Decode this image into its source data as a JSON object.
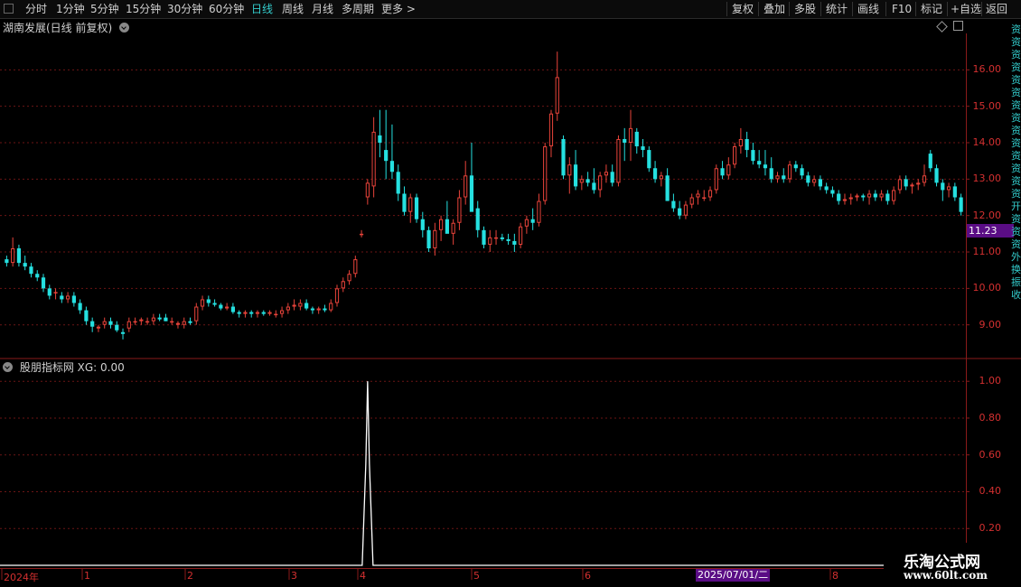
{
  "toolbar": {
    "left_items": [
      "分时",
      "1分钟",
      "5分钟",
      "15分钟",
      "30分钟",
      "60分钟",
      "日线",
      "周线",
      "月线",
      "多周期",
      "更多 >"
    ],
    "active": "日线",
    "right_items": [
      "复权",
      "叠加",
      "多股",
      "统计",
      "画线",
      "F10",
      "标记",
      "+自选",
      "返回"
    ]
  },
  "main_panel": {
    "title": "湖南发展(日线 前复权)",
    "current_price": "11.23"
  },
  "indicator_panel": {
    "title": "股朋指标网  XG: 0.00"
  },
  "dates": {
    "ticks": [
      "2024年",
      "1",
      "2",
      "3",
      "4",
      "5",
      "6",
      "8"
    ],
    "highlight": "2025/07/01/二"
  },
  "watermark": {
    "line1": "乐淘公式网",
    "line2": "www.60lt.com"
  },
  "right_strip_text": [
    "资",
    "资",
    "资",
    "资",
    "资",
    "资",
    "资",
    "资",
    "资",
    "资",
    "资",
    "资",
    "资",
    "资",
    "开",
    "资",
    "资",
    "资",
    "外",
    "换",
    "振",
    "收"
  ],
  "colors": {
    "up": "#e8433a",
    "down": "#25e0e0",
    "accent": "#5a0d85",
    "grid": "#6b1515"
  },
  "chart_data": [
    {
      "type": "candlestick",
      "title": "湖南发展(日线 前复权)",
      "y_ticks": [
        "16.00",
        "15.00",
        "14.00",
        "13.00",
        "12.00",
        "11.00",
        "10.00",
        "9.00"
      ],
      "ylim": [
        8.1,
        17.0
      ],
      "candles": [
        [
          10.8,
          10.9,
          10.6,
          10.7
        ],
        [
          10.7,
          11.4,
          10.6,
          11.1
        ],
        [
          11.1,
          11.2,
          10.6,
          10.7
        ],
        [
          10.7,
          10.9,
          10.5,
          10.6
        ],
        [
          10.6,
          10.7,
          10.3,
          10.4
        ],
        [
          10.4,
          10.5,
          10.2,
          10.3
        ],
        [
          10.3,
          10.4,
          9.9,
          10.0
        ],
        [
          10.0,
          10.1,
          9.7,
          9.8
        ],
        [
          9.9,
          10.0,
          9.7,
          9.9
        ],
        [
          9.8,
          9.9,
          9.6,
          9.7
        ],
        [
          9.7,
          9.9,
          9.6,
          9.8
        ],
        [
          9.8,
          9.9,
          9.5,
          9.6
        ],
        [
          9.6,
          9.7,
          9.3,
          9.4
        ],
        [
          9.4,
          9.5,
          9.0,
          9.1
        ],
        [
          9.1,
          9.2,
          8.8,
          8.95
        ],
        [
          8.9,
          9.0,
          8.8,
          8.95
        ],
        [
          9.0,
          9.2,
          8.9,
          9.1
        ],
        [
          9.1,
          9.2,
          8.9,
          9.0
        ],
        [
          9.0,
          9.1,
          8.8,
          8.85
        ],
        [
          8.8,
          8.9,
          8.6,
          8.75
        ],
        [
          8.9,
          9.2,
          8.8,
          9.1
        ],
        [
          9.1,
          9.2,
          9.0,
          9.1
        ],
        [
          9.1,
          9.2,
          9.0,
          9.15
        ],
        [
          9.1,
          9.2,
          9.0,
          9.1
        ],
        [
          9.1,
          9.3,
          9.0,
          9.2
        ],
        [
          9.2,
          9.3,
          9.1,
          9.15
        ],
        [
          9.2,
          9.3,
          9.1,
          9.1
        ],
        [
          9.1,
          9.2,
          9.0,
          9.1
        ],
        [
          9.0,
          9.1,
          8.9,
          9.05
        ],
        [
          9.0,
          9.2,
          8.9,
          9.1
        ],
        [
          9.1,
          9.2,
          9.0,
          9.05
        ],
        [
          9.1,
          9.6,
          9.0,
          9.5
        ],
        [
          9.5,
          9.8,
          9.4,
          9.7
        ],
        [
          9.7,
          9.8,
          9.5,
          9.6
        ],
        [
          9.6,
          9.7,
          9.5,
          9.55
        ],
        [
          9.55,
          9.6,
          9.4,
          9.45
        ],
        [
          9.45,
          9.6,
          9.4,
          9.5
        ],
        [
          9.5,
          9.6,
          9.3,
          9.35
        ],
        [
          9.35,
          9.4,
          9.2,
          9.3
        ],
        [
          9.3,
          9.4,
          9.2,
          9.35
        ],
        [
          9.35,
          9.4,
          9.2,
          9.3
        ],
        [
          9.3,
          9.4,
          9.2,
          9.35
        ],
        [
          9.35,
          9.4,
          9.25,
          9.3
        ],
        [
          9.3,
          9.4,
          9.25,
          9.35
        ],
        [
          9.3,
          9.4,
          9.2,
          9.3
        ],
        [
          9.3,
          9.5,
          9.2,
          9.4
        ],
        [
          9.4,
          9.6,
          9.3,
          9.5
        ],
        [
          9.5,
          9.7,
          9.4,
          9.55
        ],
        [
          9.5,
          9.7,
          9.4,
          9.6
        ],
        [
          9.6,
          9.7,
          9.4,
          9.45
        ],
        [
          9.45,
          9.5,
          9.3,
          9.4
        ],
        [
          9.4,
          9.5,
          9.3,
          9.45
        ],
        [
          9.45,
          9.55,
          9.35,
          9.4
        ],
        [
          9.4,
          9.7,
          9.35,
          9.6
        ],
        [
          9.6,
          10.1,
          9.5,
          10.0
        ],
        [
          10.0,
          10.3,
          9.9,
          10.2
        ],
        [
          10.2,
          10.5,
          10.1,
          10.4
        ],
        [
          10.4,
          10.9,
          10.3,
          10.8
        ],
        [
          11.5,
          11.6,
          11.4,
          11.5
        ],
        [
          12.5,
          13.0,
          12.3,
          12.9
        ],
        [
          12.8,
          14.7,
          12.5,
          14.3
        ],
        [
          14.2,
          14.9,
          13.6,
          14.0
        ],
        [
          13.8,
          14.9,
          13.0,
          13.5
        ],
        [
          13.5,
          14.5,
          13.0,
          13.2
        ],
        [
          13.2,
          13.4,
          12.4,
          12.6
        ],
        [
          12.6,
          12.8,
          12.0,
          12.1
        ],
        [
          12.1,
          12.6,
          11.8,
          12.5
        ],
        [
          12.5,
          12.6,
          11.8,
          11.9
        ],
        [
          11.9,
          12.1,
          11.4,
          11.6
        ],
        [
          11.6,
          11.7,
          11.0,
          11.1
        ],
        [
          11.1,
          11.8,
          10.9,
          11.6
        ],
        [
          11.6,
          12.0,
          11.3,
          11.9
        ],
        [
          11.9,
          12.4,
          11.6,
          11.5
        ],
        [
          11.5,
          11.9,
          11.2,
          11.8
        ],
        [
          11.8,
          12.7,
          11.6,
          12.5
        ],
        [
          12.5,
          13.5,
          12.3,
          13.1
        ],
        [
          13.1,
          14.0,
          12.2,
          12.1
        ],
        [
          12.2,
          12.4,
          11.4,
          11.6
        ],
        [
          11.6,
          11.7,
          11.1,
          11.2
        ],
        [
          11.2,
          11.6,
          11.0,
          11.4
        ],
        [
          11.4,
          11.6,
          11.2,
          11.4
        ],
        [
          11.4,
          11.5,
          11.3,
          11.35
        ],
        [
          11.35,
          11.5,
          11.2,
          11.3
        ],
        [
          11.3,
          11.5,
          11.0,
          11.2
        ],
        [
          11.2,
          11.8,
          11.1,
          11.7
        ],
        [
          11.7,
          12.0,
          11.5,
          11.9
        ],
        [
          11.9,
          12.2,
          11.6,
          11.8
        ],
        [
          11.8,
          12.6,
          11.7,
          12.4
        ],
        [
          12.4,
          14.0,
          12.3,
          13.9
        ],
        [
          13.9,
          14.9,
          13.6,
          14.8
        ],
        [
          14.8,
          16.5,
          14.6,
          15.8
        ],
        [
          14.1,
          14.2,
          13.0,
          13.1
        ],
        [
          13.1,
          13.6,
          12.6,
          13.4
        ],
        [
          13.4,
          13.8,
          12.7,
          12.8
        ],
        [
          12.9,
          13.1,
          12.7,
          13.0
        ],
        [
          13.0,
          13.2,
          12.8,
          12.9
        ],
        [
          12.9,
          13.3,
          12.6,
          12.7
        ],
        [
          12.7,
          13.2,
          12.5,
          13.1
        ],
        [
          13.1,
          13.4,
          12.9,
          13.2
        ],
        [
          13.2,
          13.4,
          12.8,
          12.9
        ],
        [
          12.9,
          14.2,
          12.8,
          14.1
        ],
        [
          14.1,
          14.4,
          13.5,
          14.0
        ],
        [
          14.0,
          14.9,
          13.5,
          14.4
        ],
        [
          14.3,
          14.4,
          13.7,
          13.9
        ],
        [
          13.9,
          14.1,
          13.6,
          13.8
        ],
        [
          13.8,
          13.9,
          13.2,
          13.3
        ],
        [
          13.3,
          13.5,
          12.9,
          13.0
        ],
        [
          13.0,
          13.2,
          12.8,
          13.1
        ],
        [
          13.1,
          13.3,
          12.4,
          12.4
        ],
        [
          12.4,
          12.6,
          12.1,
          12.2
        ],
        [
          12.2,
          12.4,
          11.9,
          12.0
        ],
        [
          12.0,
          12.4,
          11.9,
          12.3
        ],
        [
          12.3,
          12.6,
          12.2,
          12.5
        ],
        [
          12.5,
          12.7,
          12.3,
          12.6
        ],
        [
          12.5,
          12.7,
          12.4,
          12.5
        ],
        [
          12.5,
          12.8,
          12.4,
          12.7
        ],
        [
          12.7,
          13.4,
          12.6,
          13.3
        ],
        [
          13.3,
          13.5,
          13.0,
          13.1
        ],
        [
          13.1,
          13.6,
          13.0,
          13.4
        ],
        [
          13.4,
          14.0,
          13.3,
          13.9
        ],
        [
          13.9,
          14.4,
          13.7,
          14.1
        ],
        [
          14.1,
          14.3,
          13.6,
          13.8
        ],
        [
          13.8,
          14.0,
          13.4,
          13.5
        ],
        [
          13.5,
          13.8,
          13.3,
          13.4
        ],
        [
          13.4,
          13.8,
          13.1,
          13.3
        ],
        [
          13.3,
          13.6,
          12.9,
          13.0
        ],
        [
          13.0,
          13.2,
          12.9,
          13.1
        ],
        [
          13.1,
          13.3,
          12.9,
          13.0
        ],
        [
          13.0,
          13.5,
          12.9,
          13.4
        ],
        [
          13.4,
          13.5,
          13.2,
          13.3
        ],
        [
          13.3,
          13.4,
          13.0,
          13.1
        ],
        [
          13.1,
          13.2,
          12.8,
          12.9
        ],
        [
          12.9,
          13.1,
          12.8,
          13.0
        ],
        [
          13.0,
          13.1,
          12.7,
          12.8
        ],
        [
          12.8,
          12.9,
          12.6,
          12.7
        ],
        [
          12.7,
          12.8,
          12.5,
          12.6
        ],
        [
          12.6,
          12.7,
          12.3,
          12.4
        ],
        [
          12.4,
          12.6,
          12.3,
          12.45
        ],
        [
          12.45,
          12.6,
          12.3,
          12.5
        ],
        [
          12.5,
          12.6,
          12.4,
          12.55
        ],
        [
          12.55,
          12.6,
          12.4,
          12.5
        ],
        [
          12.5,
          12.7,
          12.3,
          12.6
        ],
        [
          12.6,
          12.7,
          12.4,
          12.5
        ],
        [
          12.5,
          12.7,
          12.4,
          12.6
        ],
        [
          12.6,
          12.7,
          12.3,
          12.4
        ],
        [
          12.4,
          12.8,
          12.3,
          12.7
        ],
        [
          12.7,
          13.1,
          12.6,
          13.0
        ],
        [
          13.0,
          13.1,
          12.7,
          12.8
        ],
        [
          12.8,
          12.9,
          12.6,
          12.85
        ],
        [
          12.85,
          13.0,
          12.7,
          12.9
        ],
        [
          12.9,
          13.4,
          12.8,
          13.1
        ],
        [
          13.7,
          13.8,
          13.2,
          13.3
        ],
        [
          13.3,
          13.4,
          12.8,
          12.9
        ],
        [
          12.9,
          13.0,
          12.4,
          12.7
        ],
        [
          12.7,
          12.9,
          12.5,
          12.8
        ],
        [
          12.8,
          12.9,
          12.4,
          12.5
        ],
        [
          12.5,
          12.6,
          12.0,
          12.1
        ]
      ],
      "current_price": 11.23
    },
    {
      "type": "line",
      "title": "股朋指标网  XG: 0.00",
      "y_ticks": [
        "1.00",
        "0.80",
        "0.60",
        "0.40",
        "0.20"
      ],
      "ylim": [
        0,
        1.05
      ],
      "series": [
        {
          "values": "spike",
          "spike_index": 59,
          "spike_value": 1.0
        }
      ],
      "bar_count": 152
    }
  ]
}
